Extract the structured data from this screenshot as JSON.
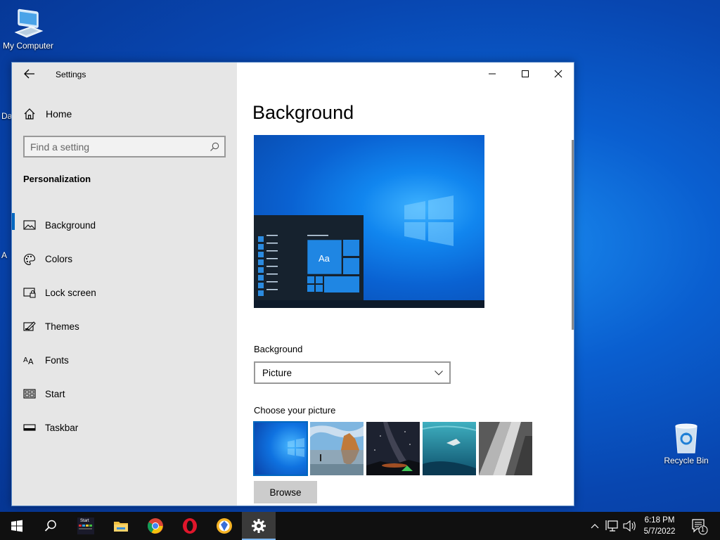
{
  "desktop": {
    "my_computer_label": "My Computer",
    "recycle_bin_label": "Recycle Bin",
    "edge_texts": [
      "Da",
      "A"
    ]
  },
  "window": {
    "app_title": "Settings",
    "controls": {
      "minimize": "minimize-icon",
      "maximize": "maximize-icon",
      "close": "close-icon"
    }
  },
  "nav": {
    "home_label": "Home",
    "search_placeholder": "Find a setting",
    "section_heading": "Personalization",
    "items": [
      {
        "label": "Background",
        "icon": "picture-icon",
        "active": true
      },
      {
        "label": "Colors",
        "icon": "palette-icon",
        "active": false
      },
      {
        "label": "Lock screen",
        "icon": "lock-screen-icon",
        "active": false
      },
      {
        "label": "Themes",
        "icon": "themes-icon",
        "active": false
      },
      {
        "label": "Fonts",
        "icon": "fonts-icon",
        "active": false
      },
      {
        "label": "Start",
        "icon": "start-layout-icon",
        "active": false
      },
      {
        "label": "Taskbar",
        "icon": "taskbar-icon",
        "active": false
      }
    ]
  },
  "content": {
    "page_title": "Background",
    "preview_tile_text": "Aa",
    "background_label": "Background",
    "background_value": "Picture",
    "choose_label": "Choose your picture",
    "browse_label": "Browse"
  },
  "taskbar": {
    "apps": [
      "start-icon",
      "search-icon",
      "start-app-icon",
      "file-explorer-icon",
      "chrome-icon",
      "opera-icon",
      "browser-icon",
      "settings-icon"
    ],
    "start_app_label": "Start",
    "time": "6:18 PM",
    "date": "5/7/2022",
    "notification_count": "1"
  },
  "colors": {
    "accent": "#0067c0",
    "nav_bg": "#e6e6e6",
    "taskbar_bg": "#101010"
  }
}
